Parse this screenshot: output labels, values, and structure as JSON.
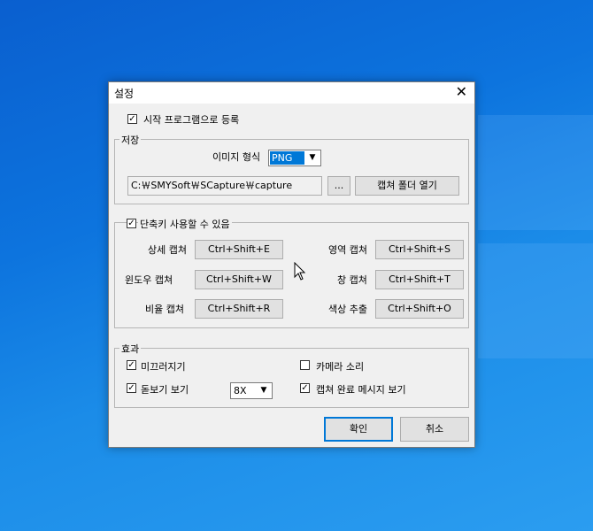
{
  "dialog": {
    "title": "설정",
    "close_glyph": "✕",
    "startup_label": "시작 프로그램으로 등록",
    "startup_checked": true,
    "save": {
      "legend": "저장",
      "format_label": "이미지 형식",
      "format_value": "PNG",
      "path_value": "C:￦SMYSoft￦SCapture￦capture",
      "browse_label": "...",
      "open_folder_label": "캡쳐 폴더 열기"
    },
    "hotkeys": {
      "legend": "단축키 사용할 수 있음",
      "enabled": true,
      "items": [
        {
          "label": "상세 캡쳐",
          "key": "Ctrl+Shift+E"
        },
        {
          "label": "영역 캡쳐",
          "key": "Ctrl+Shift+S"
        },
        {
          "label": "윈도우 캡쳐",
          "key": "Ctrl+Shift+W"
        },
        {
          "label": "창 캡쳐",
          "key": "Ctrl+Shift+T"
        },
        {
          "label": "비율 캡쳐",
          "key": "Ctrl+Shift+R"
        },
        {
          "label": "색상 추출",
          "key": "Ctrl+Shift+O"
        }
      ]
    },
    "effects": {
      "legend": "효과",
      "slide_label": "미끄러지기",
      "slide_checked": true,
      "camera_sound_label": "카메라 소리",
      "camera_sound_checked": false,
      "magnifier_label": "돋보기 보기",
      "magnifier_checked": true,
      "zoom_value": "8X",
      "complete_msg_label": "캡쳐 완료 메시지 보기",
      "complete_msg_checked": true
    },
    "ok_label": "확인",
    "cancel_label": "취소"
  },
  "glyphs": {
    "check": "✓",
    "dropdown": "▼"
  },
  "colors": {
    "desktop": "#0d74de",
    "accent": "#0078d7",
    "dialog_bg": "#f0f0f0"
  }
}
